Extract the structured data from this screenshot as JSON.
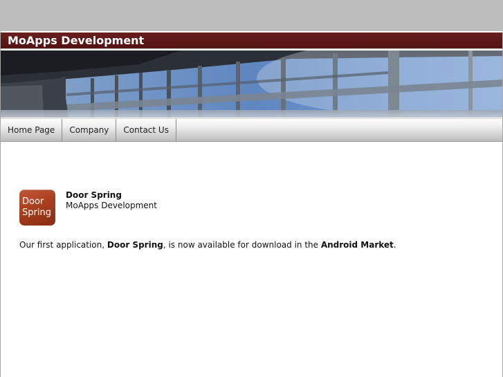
{
  "site": {
    "title": "MoApps Development"
  },
  "nav": {
    "items": [
      {
        "label": "Home Page"
      },
      {
        "label": "Company"
      },
      {
        "label": "Contact Us"
      }
    ]
  },
  "app": {
    "icon_text_line1": "Door",
    "icon_text_line2": "Spring",
    "name": "Door Spring",
    "developer": "MoApps Development"
  },
  "announcement": {
    "prefix": "Our first application, ",
    "app_name": "Door Spring",
    "middle": ", is now available for download in the ",
    "store": "Android Market",
    "suffix": "."
  },
  "colors": {
    "title_bar": "#5c1818",
    "icon": "#a8401f",
    "background": "#bdbdbd"
  }
}
